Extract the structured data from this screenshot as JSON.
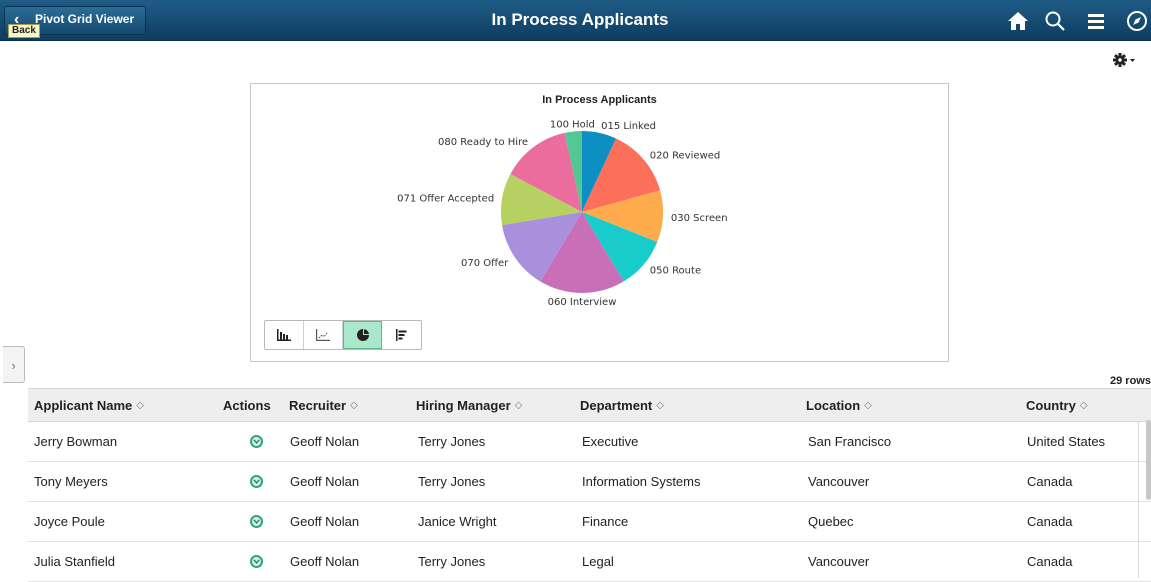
{
  "header": {
    "back_label": "Pivot Grid Viewer",
    "back_tooltip": "Back",
    "title": "In Process Applicants",
    "icons": [
      "home-icon",
      "search-icon",
      "menu-icon",
      "navigator-icon"
    ]
  },
  "settings_icon": "gear-icon",
  "chart_types": [
    "bar-chart-icon",
    "line-chart-icon",
    "pie-chart-icon",
    "horizontal-bar-chart-icon"
  ],
  "chart_types_selected": "pie-chart-icon",
  "chart_data": {
    "type": "pie",
    "title": "In Process Applicants",
    "slices": [
      {
        "label": "015 Linked",
        "value": 2,
        "color": "#0e8fc4"
      },
      {
        "label": "020 Reviewed",
        "value": 4,
        "color": "#fb6f5b"
      },
      {
        "label": "030 Screen",
        "value": 3,
        "color": "#feab4d"
      },
      {
        "label": "050 Route",
        "value": 3,
        "color": "#18cccc"
      },
      {
        "label": "060 Interview",
        "value": 5,
        "color": "#c96fb8"
      },
      {
        "label": "070 Offer",
        "value": 4,
        "color": "#a890dc"
      },
      {
        "label": "071 Offer Accepted",
        "value": 3,
        "color": "#b6d162"
      },
      {
        "label": "080 Ready to Hire",
        "value": 4,
        "color": "#ea6d9d"
      },
      {
        "label": "100 Hold",
        "value": 1,
        "color": "#55c792"
      }
    ]
  },
  "row_count": "29 rows",
  "grid": {
    "columns": [
      "Applicant Name",
      "Actions",
      "Recruiter",
      "Hiring Manager",
      "Department",
      "Location",
      "Country"
    ],
    "rows": [
      [
        "Jerry Bowman",
        "",
        "Geoff Nolan",
        "Terry Jones",
        "Executive",
        "San Francisco",
        "United States"
      ],
      [
        "Tony Meyers",
        "",
        "Geoff Nolan",
        "Terry Jones",
        "Information Systems",
        "Vancouver",
        "Canada"
      ],
      [
        "Joyce Poule",
        "",
        "Geoff Nolan",
        "Janice Wright",
        "Finance",
        "Quebec",
        "Canada"
      ],
      [
        "Julia Stanfield",
        "",
        "Geoff Nolan",
        "Terry Jones",
        "Legal",
        "Vancouver",
        "Canada"
      ]
    ]
  }
}
